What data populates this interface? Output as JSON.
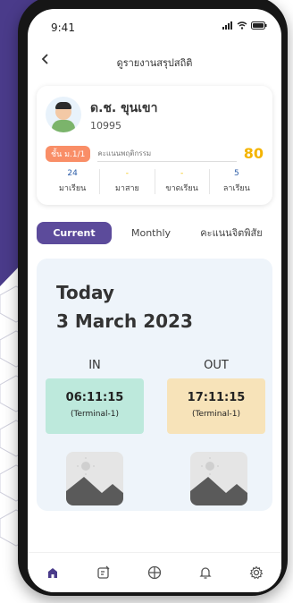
{
  "status": {
    "time": "9:41"
  },
  "nav": {
    "title": "ดูรายงานสรุปสถิติ"
  },
  "student": {
    "name": "ด.ช. ขุนเขา",
    "id": "10995",
    "class_badge": "ชั้น ม.1/1",
    "score_label": "คะแนนพฤติกรรม",
    "score_value": "80",
    "stats": [
      {
        "value": "24",
        "label": "มาเรียน"
      },
      {
        "value": "-",
        "label": "มาสาย"
      },
      {
        "value": "-",
        "label": "ขาดเรียน"
      },
      {
        "value": "5",
        "label": "ลาเรียน"
      }
    ]
  },
  "tabs": [
    {
      "label": "Current"
    },
    {
      "label": "Monthly"
    },
    {
      "label": "คะแนนจิตพิสัย"
    }
  ],
  "attendance": {
    "heading": "Today",
    "date": "3 March 2023",
    "in": {
      "title": "IN",
      "time": "06:11:15",
      "terminal": "(Terminal-1)"
    },
    "out": {
      "title": "OUT",
      "time": "17:11:15",
      "terminal": "(Terminal-1)"
    }
  },
  "colors": {
    "accent": "#5c4b9b",
    "score": "#f4b400",
    "badge": "#f98e67",
    "in_box": "#bde9dc",
    "out_box": "#f7e3b9"
  },
  "bottom_nav": [
    {
      "icon": "home-icon"
    },
    {
      "icon": "edit-note-icon"
    },
    {
      "icon": "grid-circle-icon"
    },
    {
      "icon": "bell-icon"
    },
    {
      "icon": "settings-icon"
    }
  ]
}
